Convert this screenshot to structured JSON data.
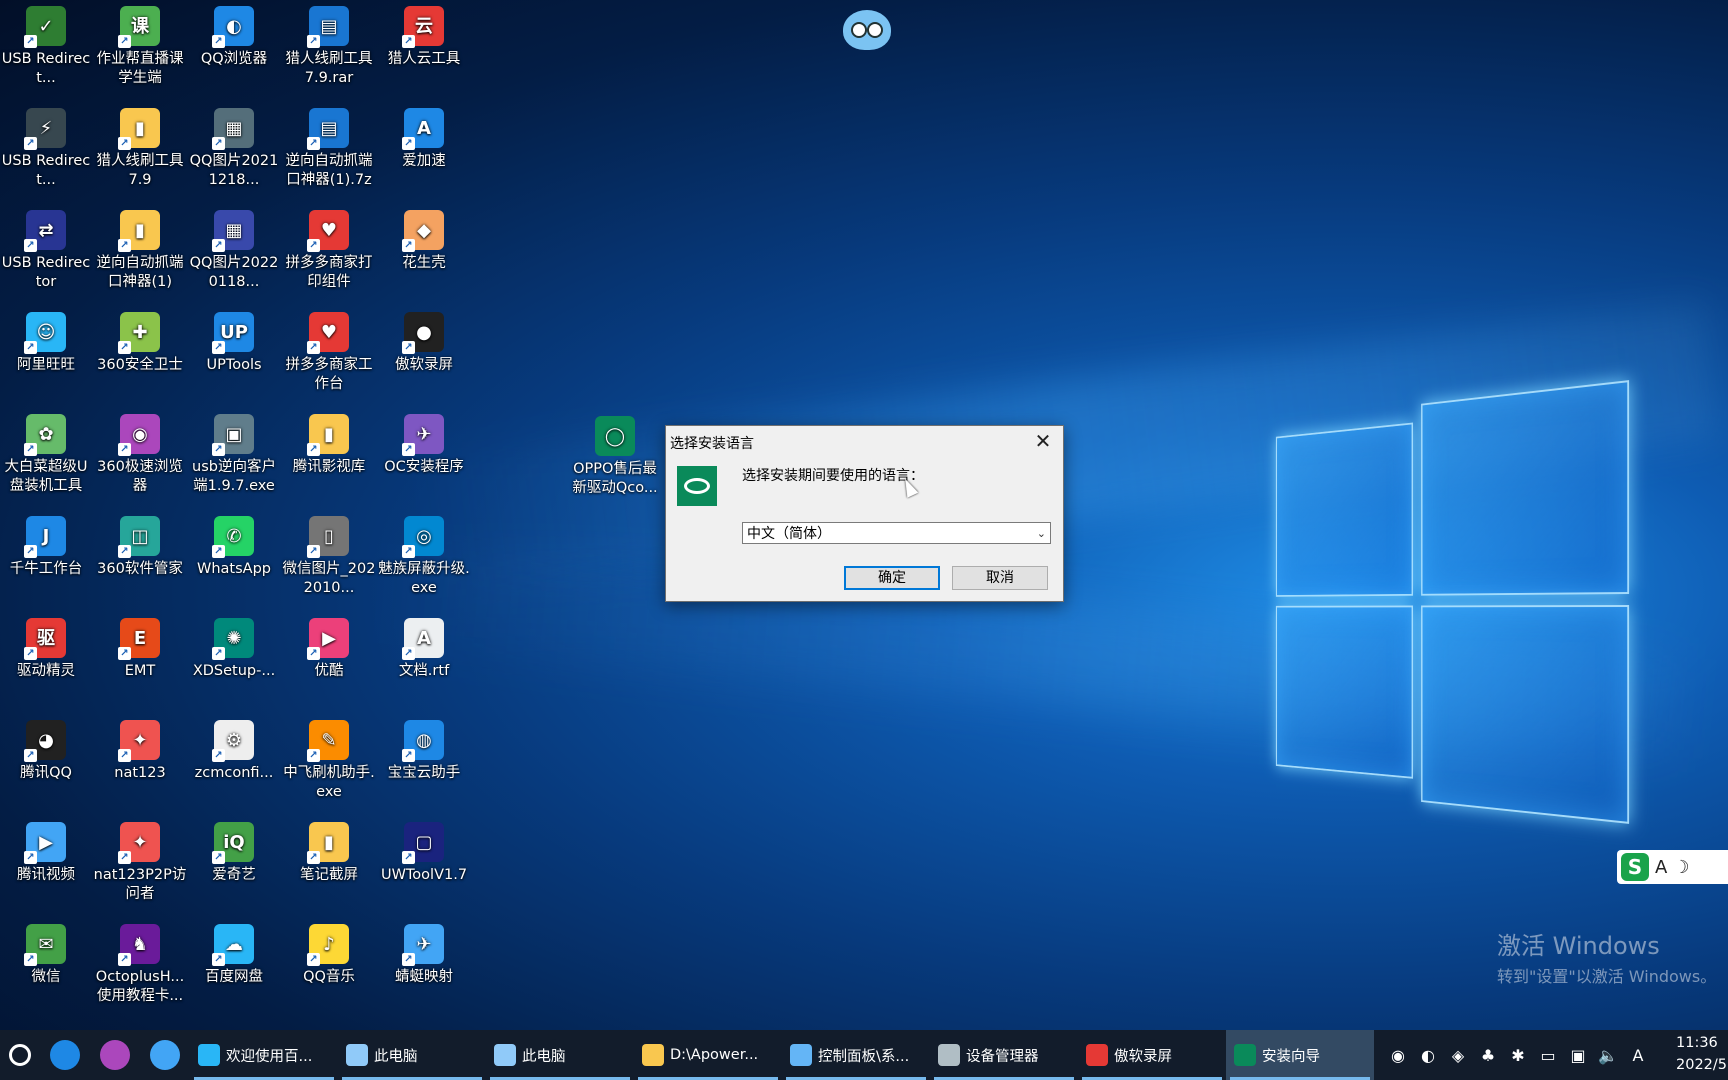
{
  "desktop": {
    "icons": [
      {
        "label": "USB Redirect...",
        "color": "#2e7d32",
        "glyph": "✓"
      },
      {
        "label": "作业帮直播课学生端",
        "color": "#4caf50",
        "glyph": "课"
      },
      {
        "label": "QQ浏览器",
        "color": "#1e88e5",
        "glyph": "◐"
      },
      {
        "label": "猎人线刷工具7.9.rar",
        "color": "#1976d2",
        "glyph": "▤"
      },
      {
        "label": "猎人云工具",
        "color": "#e53935",
        "glyph": "云"
      },
      {
        "label": "USB Redirect...",
        "color": "#37474f",
        "glyph": "⚡"
      },
      {
        "label": "猎人线刷工具7.9",
        "color": "#f9c74f",
        "glyph": "▮"
      },
      {
        "label": "QQ图片20211218...",
        "color": "#546e7a",
        "glyph": "▦"
      },
      {
        "label": "逆向自动抓端口神器(1).7z",
        "color": "#1976d2",
        "glyph": "▤"
      },
      {
        "label": "爱加速",
        "color": "#1e88e5",
        "glyph": "A"
      },
      {
        "label": "USB Redirector",
        "color": "#283593",
        "glyph": "⇄"
      },
      {
        "label": "逆向自动抓端口神器(1)",
        "color": "#f9c74f",
        "glyph": "▮"
      },
      {
        "label": "QQ图片20220118...",
        "color": "#3949ab",
        "glyph": "▦"
      },
      {
        "label": "拼多多商家打印组件",
        "color": "#e53935",
        "glyph": "♥"
      },
      {
        "label": "花生壳",
        "color": "#f4a261",
        "glyph": "◆"
      },
      {
        "label": "阿里旺旺",
        "color": "#29b6f6",
        "glyph": "☺"
      },
      {
        "label": "360安全卫士",
        "color": "#8bc34a",
        "glyph": "✚"
      },
      {
        "label": "UPTools",
        "color": "#1e88e5",
        "glyph": "UP"
      },
      {
        "label": "拼多多商家工作台",
        "color": "#e53935",
        "glyph": "♥"
      },
      {
        "label": "傲软录屏",
        "color": "#212121",
        "glyph": "●"
      },
      {
        "label": "大白菜超级U盘装机工具",
        "color": "#66bb6a",
        "glyph": "✿"
      },
      {
        "label": "360极速浏览器",
        "color": "#ab47bc",
        "glyph": "◉"
      },
      {
        "label": "usb逆向客户端1.9.7.exe",
        "color": "#607d8b",
        "glyph": "▣"
      },
      {
        "label": "腾讯影视库",
        "color": "#f9c74f",
        "glyph": "▮"
      },
      {
        "label": "OC安装程序",
        "color": "#7e57c2",
        "glyph": "✈"
      },
      {
        "label": "千牛工作台",
        "color": "#1e88e5",
        "glyph": "J"
      },
      {
        "label": "360软件管家",
        "color": "#26a69a",
        "glyph": "◫"
      },
      {
        "label": "WhatsApp",
        "color": "#25d366",
        "glyph": "✆"
      },
      {
        "label": "微信图片_2022010...",
        "color": "#757575",
        "glyph": "▯"
      },
      {
        "label": "魅族屏蔽升级.exe",
        "color": "#0288d1",
        "glyph": "◎"
      },
      {
        "label": "驱动精灵",
        "color": "#e53935",
        "glyph": "驱"
      },
      {
        "label": "EMT",
        "color": "#e64a19",
        "glyph": "E"
      },
      {
        "label": "XDSetup-...",
        "color": "#00897b",
        "glyph": "✺"
      },
      {
        "label": "优酷",
        "color": "#ec407a",
        "glyph": "▶"
      },
      {
        "label": "文档.rtf",
        "color": "#eceff1",
        "glyph": "A"
      },
      {
        "label": "腾讯QQ",
        "color": "#212121",
        "glyph": "◕"
      },
      {
        "label": "nat123",
        "color": "#ef5350",
        "glyph": "✦"
      },
      {
        "label": "zcmconfi...",
        "color": "#eeeeee",
        "glyph": "⚙"
      },
      {
        "label": "中飞刷机助手.exe",
        "color": "#fb8c00",
        "glyph": "✎"
      },
      {
        "label": "宝宝云助手",
        "color": "#1e88e5",
        "glyph": "◍"
      },
      {
        "label": "腾讯视频",
        "color": "#42a5f5",
        "glyph": "▶"
      },
      {
        "label": "nat123P2P访问者",
        "color": "#ef5350",
        "glyph": "✦"
      },
      {
        "label": "爱奇艺",
        "color": "#43a047",
        "glyph": "iQ"
      },
      {
        "label": "笔记截屏",
        "color": "#f9c74f",
        "glyph": "▮"
      },
      {
        "label": "UWToolV1.7",
        "color": "#1a237e",
        "glyph": "▢"
      },
      {
        "label": "微信",
        "color": "#43a047",
        "glyph": "✉"
      },
      {
        "label": "OctoplusH...使用教程卡...",
        "color": "#6a1b9a",
        "glyph": "♞"
      },
      {
        "label": "百度网盘",
        "color": "#29b6f6",
        "glyph": "☁"
      },
      {
        "label": "QQ音乐",
        "color": "#fdd835",
        "glyph": "♪"
      },
      {
        "label": "蜻蜓映射",
        "color": "#42a5f5",
        "glyph": "✈"
      }
    ],
    "extra_icon": {
      "label": "OPPO售后最新驱动Qco...",
      "color": "#0a8a5a",
      "glyph": "◯"
    }
  },
  "dialog": {
    "title": "选择安装语言",
    "close_glyph": "✕",
    "prompt": "选择安装期间要使用的语言：",
    "selected_language": "中文（简体）",
    "ok_label": "确定",
    "cancel_label": "取消"
  },
  "watermark": {
    "line1": "激活 Windows",
    "line2": "转到\"设置\"以激活 Windows。"
  },
  "ime": {
    "logo": "S",
    "mode": "A",
    "moon": "☽"
  },
  "taskbar": {
    "pinned": [
      {
        "name": "qq-browser-icon",
        "color": "#1e88e5"
      },
      {
        "name": "360-browser-icon",
        "color": "#ab47bc"
      },
      {
        "name": "tencent-video-icon",
        "color": "#42a5f5"
      }
    ],
    "items": [
      {
        "label": "欢迎使用百...",
        "color": "#29b6f6",
        "active": false
      },
      {
        "label": "此电脑",
        "color": "#90caf9",
        "active": false
      },
      {
        "label": "此电脑",
        "color": "#90caf9",
        "active": false
      },
      {
        "label": "D:\\Apower...",
        "color": "#f9c74f",
        "active": false
      },
      {
        "label": "控制面板\\系...",
        "color": "#64b5f6",
        "active": false
      },
      {
        "label": "设备管理器",
        "color": "#b0bec5",
        "active": false
      },
      {
        "label": "傲软录屏",
        "color": "#e53935",
        "active": false
      },
      {
        "label": "安装向导",
        "color": "#0a8a5a",
        "active": true
      }
    ],
    "tray": [
      "◉",
      "◐",
      "◈",
      "♣",
      "✱",
      "▭",
      "▣",
      "🔈",
      "A"
    ],
    "time": "11:36",
    "date": "2022/5"
  }
}
